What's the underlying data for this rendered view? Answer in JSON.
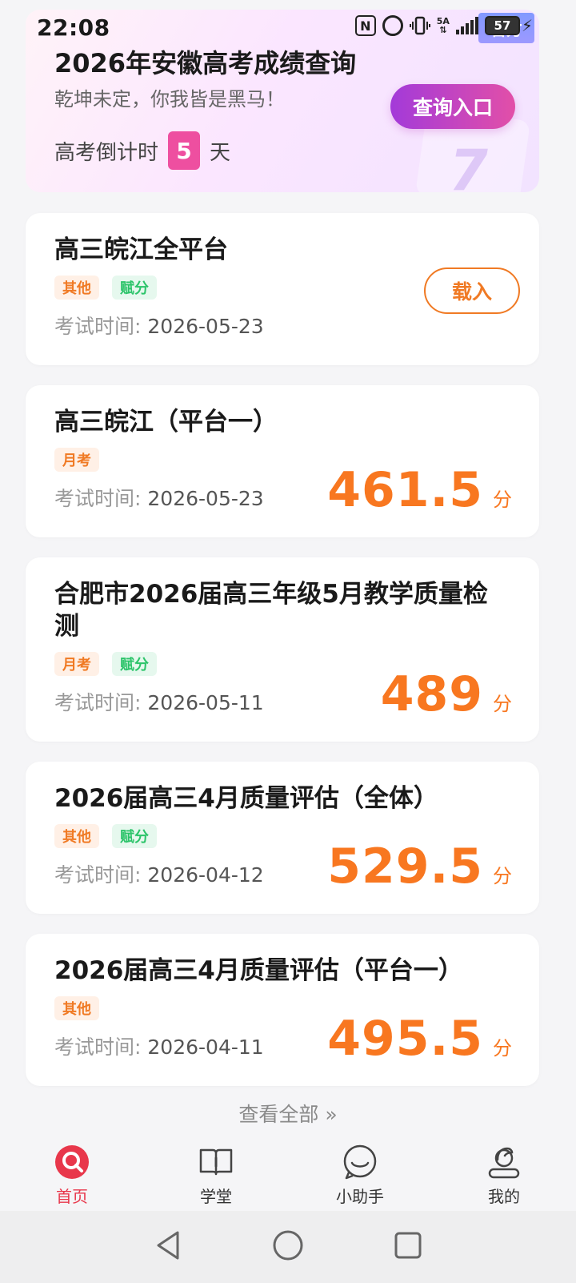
{
  "status_bar": {
    "time": "22:08",
    "network": "5A",
    "battery": "57",
    "official_badge": "官方"
  },
  "hero": {
    "title": "2026年安徽高考成绩查询",
    "subtitle": "乾坤未定，你我皆是黑马！",
    "button_label": "查询入口",
    "countdown_prefix": "高考倒计时",
    "countdown_days": "5",
    "countdown_suffix": "天",
    "deco_number": "7"
  },
  "exams": [
    {
      "title": "高三皖江全平台",
      "tags": [
        "其他",
        "赋分"
      ],
      "time_label": "考试时间:",
      "date": "2026-05-23",
      "action_label": "载入",
      "score": null
    },
    {
      "title": "高三皖江（平台一）",
      "tags": [
        "月考"
      ],
      "time_label": "考试时间:",
      "date": "2026-05-23",
      "score": "461.5",
      "unit": "分"
    },
    {
      "title": "合肥市2026届高三年级5月教学质量检测",
      "tags": [
        "月考",
        "赋分"
      ],
      "time_label": "考试时间:",
      "date": "2026-05-11",
      "score": "489",
      "unit": "分"
    },
    {
      "title": "2026届高三4月质量评估（全体）",
      "tags": [
        "其他",
        "赋分"
      ],
      "time_label": "考试时间:",
      "date": "2026-04-12",
      "score": "529.5",
      "unit": "分"
    },
    {
      "title": "2026届高三4月质量评估（平台一）",
      "tags": [
        "其他"
      ],
      "time_label": "考试时间:",
      "date": "2026-04-11",
      "score": "495.5",
      "unit": "分"
    }
  ],
  "view_all": "查看全部 »",
  "tabbar": [
    {
      "label": "首页",
      "icon": "home-search-icon",
      "active": true
    },
    {
      "label": "学堂",
      "icon": "book-icon",
      "active": false
    },
    {
      "label": "小助手",
      "icon": "smile-icon",
      "active": false
    },
    {
      "label": "我的",
      "icon": "user-icon",
      "active": false
    }
  ],
  "colors": {
    "accent_orange": "#f87720",
    "accent_pink": "#ee4fa0",
    "tab_active": "#e8374b",
    "tag_green": "#2cc46a"
  }
}
